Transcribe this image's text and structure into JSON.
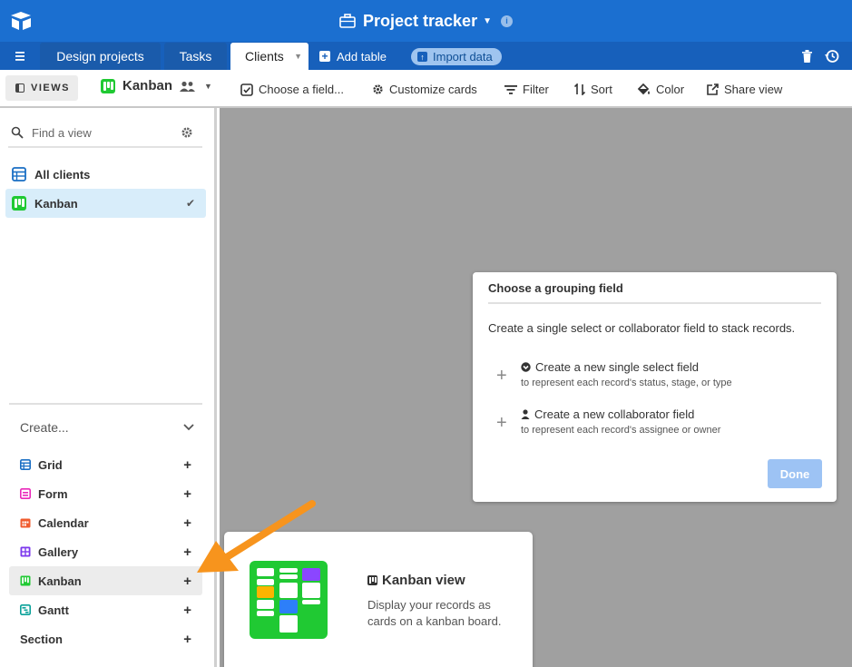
{
  "header": {
    "base_title": "Project tracker",
    "logo_icon": "airtable-logo-icon",
    "info_icon": "info-icon"
  },
  "tabs": {
    "items": [
      {
        "label": "Design projects"
      },
      {
        "label": "Tasks"
      },
      {
        "label": "Clients",
        "active": true
      }
    ],
    "add_table": "Add table",
    "import_data": "Import data"
  },
  "viewbar": {
    "views_label": "VIEWS",
    "view_name": "Kanban",
    "tools": {
      "choose_field": "Choose a field...",
      "customize_cards": "Customize cards",
      "filter": "Filter",
      "sort": "Sort",
      "color": "Color",
      "share_view": "Share view"
    }
  },
  "sidebar": {
    "find_placeholder": "Find a view",
    "views": [
      {
        "label": "All clients",
        "icon": "grid-icon"
      },
      {
        "label": "Kanban",
        "icon": "kanban-icon",
        "selected": true,
        "check": "✔"
      }
    ],
    "create_label": "Create...",
    "create_items": [
      {
        "label": "Grid",
        "icon": "grid-icon",
        "color": "#1a6fc4"
      },
      {
        "label": "Form",
        "icon": "form-icon",
        "color": "#e929ba"
      },
      {
        "label": "Calendar",
        "icon": "calendar-icon",
        "color": "#f05c2f"
      },
      {
        "label": "Gallery",
        "icon": "gallery-icon",
        "color": "#7c39ed"
      },
      {
        "label": "Kanban",
        "icon": "kanban-icon",
        "color": "#20c933"
      },
      {
        "label": "Gantt",
        "icon": "gantt-icon",
        "color": "#0aa199"
      },
      {
        "label": "Section"
      }
    ]
  },
  "dialog": {
    "title": "Choose a grouping field",
    "subtitle": "Create a single select or collaborator field to stack records.",
    "options": [
      {
        "title": "Create a new single select field",
        "desc": "to represent each record's status, stage, or type",
        "icon": "chevron-circle-icon"
      },
      {
        "title": "Create a new collaborator field",
        "desc": "to represent each record's assignee or owner",
        "icon": "person-icon"
      }
    ],
    "done_label": "Done"
  },
  "tooltip": {
    "title": "Kanban view",
    "desc": "Display your records as cards on a kanban board."
  },
  "colors": {
    "topbar": "#1b6fd0",
    "tabsrow": "#1760bb",
    "kanban_green": "#20c933",
    "arrow": "#f7941d"
  }
}
